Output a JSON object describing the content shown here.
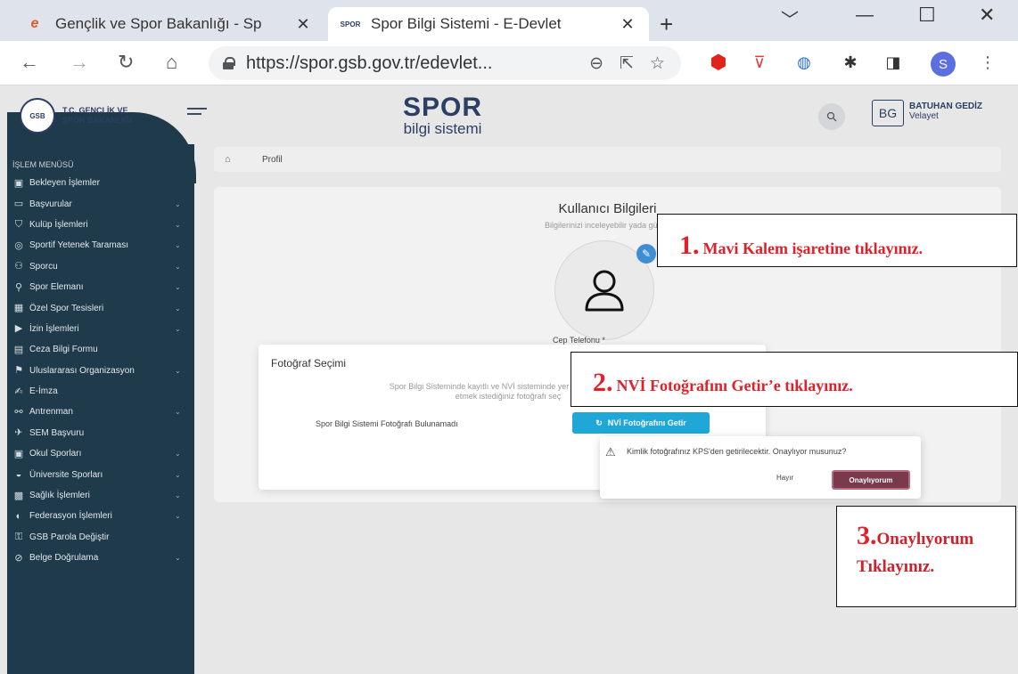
{
  "browser": {
    "tabs": [
      {
        "title": "Gençlik ve Spor Bakanlığı - Sp",
        "active": false,
        "favicon": "e-icon"
      },
      {
        "title": "Spor Bilgi Sistemi - E-Devlet",
        "active": true,
        "favicon": "spor-icon"
      }
    ],
    "url": "https://spor.gsb.gov.tr/edevlet...",
    "profile_initial": "S",
    "favicon_text": "SPOR"
  },
  "header": {
    "logo_line1": "T.C. GENÇLİK VE",
    "logo_line2": "SPOR BAKANLIĞI",
    "brand_main": "SPOR",
    "brand_sub": "bilgi sistemi",
    "user_initials": "BG",
    "user_name": "BATUHAN GEDİZ",
    "user_role": "Velayet"
  },
  "sidebar": {
    "title": "İŞLEM MENÜSÜ",
    "items": [
      {
        "label": "Bekleyen İşlemler",
        "icon": "inbox-icon",
        "chevron": false
      },
      {
        "label": "Başvurular",
        "icon": "folder-icon",
        "chevron": true
      },
      {
        "label": "Kulüp İşlemleri",
        "icon": "shield-icon",
        "chevron": true
      },
      {
        "label": "Sportif Yetenek Taraması",
        "icon": "scan-icon",
        "chevron": true
      },
      {
        "label": "Sporcu",
        "icon": "people-icon",
        "chevron": true
      },
      {
        "label": "Spor Elemanı",
        "icon": "person-add-icon",
        "chevron": true
      },
      {
        "label": "Özel Spor Tesisleri",
        "icon": "building-icon",
        "chevron": true
      },
      {
        "label": "İzin İşlemleri",
        "icon": "permit-icon",
        "chevron": true
      },
      {
        "label": "Ceza Bilgi Formu",
        "icon": "form-icon",
        "chevron": false
      },
      {
        "label": "Uluslararası Organizasyon",
        "icon": "flag-icon",
        "chevron": true
      },
      {
        "label": "E-İmza",
        "icon": "signature-icon",
        "chevron": false
      },
      {
        "label": "Antrenman",
        "icon": "bike-icon",
        "chevron": true
      },
      {
        "label": "SEM Başvuru",
        "icon": "run-icon",
        "chevron": false
      },
      {
        "label": "Okul Sporları",
        "icon": "school-icon",
        "chevron": true
      },
      {
        "label": "Üniversite Sporları",
        "icon": "graduation-icon",
        "chevron": true
      },
      {
        "label": "Sağlık İşlemleri",
        "icon": "health-icon",
        "chevron": true
      },
      {
        "label": "Federasyon İşlemleri",
        "icon": "ball-icon",
        "chevron": true
      },
      {
        "label": "GSB Parola Değiştir",
        "icon": "key-icon",
        "chevron": false
      },
      {
        "label": "Belge Doğrulama",
        "icon": "check-circle-icon",
        "chevron": true
      }
    ]
  },
  "breadcrumb": {
    "current": "Profil"
  },
  "profile": {
    "title": "Kullanıcı Bilgileri",
    "subtitle": "Bilgilerinizi inceleyebilir yada günce",
    "phone_label": "Cep Telefonu *"
  },
  "photo_modal": {
    "title": "Fotoğraf Seçimi",
    "description_line1": "Spor Bilgi Sisteminde kayıtlı ve NVİ sisteminde yer alan fotoğrafları",
    "description_line2": "etmek istediğiniz fotoğrafı seç",
    "not_found": "Spor Bilgi Sistemi Fotoğrafı Bulunamadı",
    "nvi_button": "NVİ Fotoğrafını Getir"
  },
  "confirm_popover": {
    "message": "Kimlik fotoğrafınız KPS'den getirilecektir. Onaylıyor musunuz?",
    "no_label": "Hayır",
    "yes_label": "Onaylıyorum"
  },
  "annotations": [
    {
      "num": "1.",
      "text": "Mavi Kalem işaretine tıklayınız."
    },
    {
      "num": "2.",
      "text": "NVİ Fotoğrafını Getir’e tıklayınız."
    },
    {
      "num": "3.",
      "text": "Onaylıyorum",
      "text2": "Tıklayınız."
    }
  ]
}
